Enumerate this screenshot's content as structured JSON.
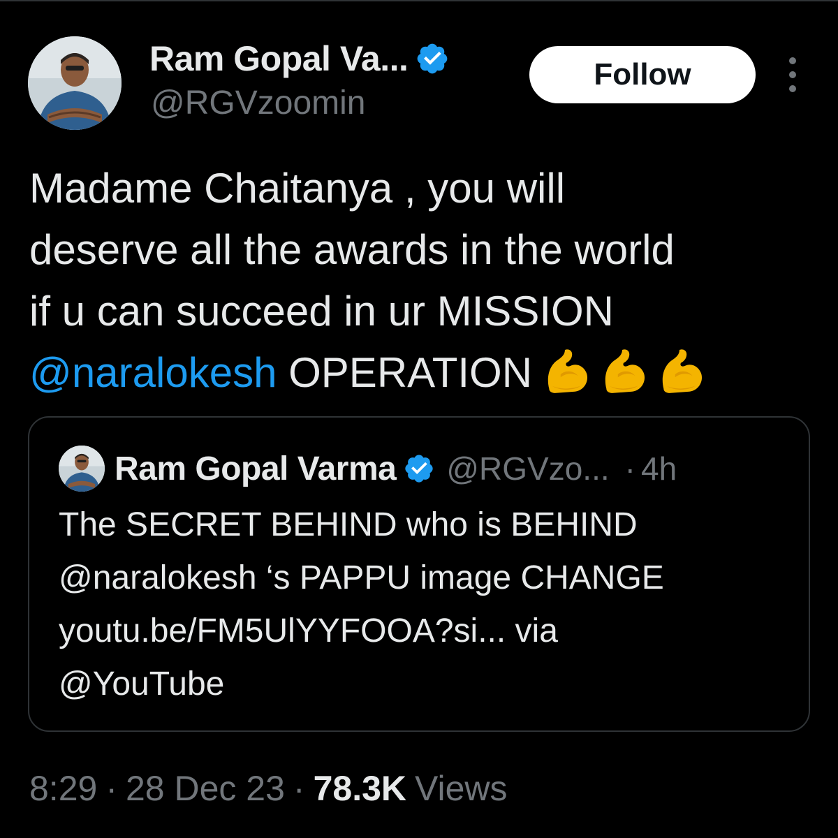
{
  "colors": {
    "background": "#000000",
    "text_primary": "#e7e9ea",
    "text_secondary": "#71767b",
    "link": "#1d9bf0",
    "verified": "#1d9bf0",
    "border": "#2f3336",
    "follow_button_bg": "#ffffff"
  },
  "tweet": {
    "author": {
      "display_name": "Ram Gopal Va...",
      "handle": "@RGVzoomin",
      "avatar_icon": "profile-photo",
      "verified_icon": "verified-badge-icon"
    },
    "follow_label": "Follow",
    "more_icon": "more-vertical-icon",
    "text_lines": [
      "Madame Chaitanya , you will",
      "deserve all the awards in the world",
      "if u can succeed in ur MISSION"
    ],
    "last_line": {
      "mention": "@naralokesh",
      "text": " OPERATION",
      "emoji": [
        "flexed-biceps-emoji",
        "flexed-biceps-emoji",
        "flexed-biceps-emoji"
      ]
    }
  },
  "quoted_tweet": {
    "display_name": "Ram Gopal Varma",
    "handle": "@RGVzo...",
    "dot": "·",
    "time": "4h",
    "text_lines": [
      "The SECRET BEHIND who is BEHIND",
      "@naralokesh ‘s PAPPU image CHANGE",
      "youtu.be/FM5UlYYFOOA?si... via",
      "@YouTube"
    ]
  },
  "meta": {
    "time": "8:29",
    "sep1": "·",
    "date": "28 Dec 23",
    "sep2": "·",
    "views_count": "78.3K",
    "views_label": "Views"
  }
}
